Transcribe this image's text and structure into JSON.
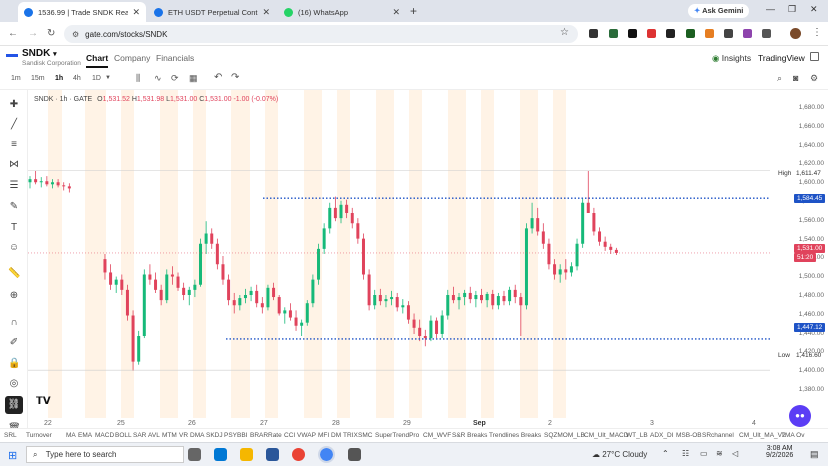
{
  "browser": {
    "tabs": [
      {
        "label": "1536.99 | Trade SNDK Real-Tim",
        "color": "#1a73e8",
        "active": true
      },
      {
        "label": "ETH USDT Perpetual Contract (",
        "color": "#1a73e8",
        "active": false
      },
      {
        "label": "(16) WhatsApp",
        "color": "#25d366",
        "active": false
      }
    ],
    "new_tab": "+",
    "ask_gemini": "Ask Gemini",
    "url": "gate.com/stocks/SNDK"
  },
  "app": {
    "symbol": "SNDK",
    "company_name": "Sandisk Corporation",
    "nav_tabs": [
      "Chart",
      "Company",
      "Financials"
    ],
    "insights": "Insights",
    "tradingview": "TradingView"
  },
  "toolbar": {
    "intervals": [
      "1m",
      "15m",
      "1h",
      "4h",
      "1D"
    ],
    "active_interval": "1h"
  },
  "legend": {
    "symbol": "SNDK · 1h · GATE",
    "o_label": "O",
    "o_value": "1,531.52",
    "h_label": "H",
    "h_value": "1,531.98",
    "l_label": "L",
    "l_value": "1,531.00",
    "c_label": "C",
    "c_value": "1,531.00",
    "change": "-1.00 (-0.07%)"
  },
  "price_axis": {
    "ticks": [
      "1,680.00",
      "1,660.00",
      "1,640.00",
      "1,620.00",
      "1,600.00",
      "1,580.00",
      "1,560.00",
      "1,540.00",
      "1,520.00",
      "1,500.00",
      "1,480.00",
      "1,460.00",
      "1,440.00",
      "1,420.00",
      "1,400.00",
      "1,380.00"
    ],
    "high_label": "High",
    "high_value": "1,611.47",
    "low_label": "Low",
    "low_value": "1,416.60",
    "resistance_value": "1,584.45",
    "support_value": "1,447.12",
    "last_value": "1,531.00",
    "countdown": "51:20"
  },
  "time_axis": {
    "labels": [
      "22",
      "25",
      "26",
      "27",
      "28",
      "29",
      "Sep",
      "2",
      "3",
      "4"
    ]
  },
  "indicators": [
    "SRL",
    "Turnover",
    "MA",
    "EMA",
    "MACD",
    "BOLL",
    "SAR",
    "AVL",
    "MTM",
    "VR",
    "DMA",
    "SKDJ",
    "PSY",
    "BBI",
    "BRAR",
    "Rate",
    "CCI",
    "VWAP",
    "MFI",
    "DM",
    "TRIX",
    "SMC",
    "SuperTrendPro",
    "CM_WVF",
    "S&R Breaks",
    "Trendlines Breaks",
    "SQZMOM_LB",
    "CM_Ult_MACD",
    "WT_LB",
    "ADX_DI",
    "MSB-OB",
    "SRchannel",
    "CM_Ult_MA_V2",
    "TMA Ov"
  ],
  "taskbar": {
    "search_placeholder": "Type here to search",
    "weather": "27°C  Cloudy",
    "time": "3:08 AM",
    "date": "9/2/2026"
  },
  "chart_data": {
    "type": "candlestick",
    "ylim": [
      1370,
      1690
    ],
    "high": 1611.47,
    "low": 1416.6,
    "resistance": 1584.45,
    "support": 1447.12,
    "last": 1531.0,
    "candles": [
      [
        1600,
        1606,
        1594,
        1603
      ],
      [
        1603,
        1611,
        1598,
        1600
      ],
      [
        1600,
        1605,
        1595,
        1601
      ],
      [
        1601,
        1606,
        1596,
        1598
      ],
      [
        1598,
        1603,
        1594,
        1600
      ],
      [
        1600,
        1603,
        1595,
        1597
      ],
      [
        1597,
        1600,
        1592,
        1596
      ],
      [
        1596,
        1599,
        1590,
        1594
      ],
      [
        1525,
        1530,
        1505,
        1512
      ],
      [
        1512,
        1520,
        1495,
        1500
      ],
      [
        1500,
        1508,
        1492,
        1505
      ],
      [
        1505,
        1510,
        1490,
        1495
      ],
      [
        1495,
        1500,
        1465,
        1470
      ],
      [
        1470,
        1475,
        1416,
        1425
      ],
      [
        1425,
        1455,
        1422,
        1450
      ],
      [
        1450,
        1515,
        1448,
        1510
      ],
      [
        1510,
        1520,
        1500,
        1505
      ],
      [
        1505,
        1512,
        1492,
        1495
      ],
      [
        1495,
        1500,
        1480,
        1485
      ],
      [
        1485,
        1515,
        1482,
        1510
      ],
      [
        1510,
        1518,
        1500,
        1508
      ],
      [
        1508,
        1512,
        1494,
        1497
      ],
      [
        1497,
        1502,
        1485,
        1490
      ],
      [
        1490,
        1498,
        1480,
        1495
      ],
      [
        1495,
        1505,
        1488,
        1500
      ],
      [
        1500,
        1545,
        1498,
        1540
      ],
      [
        1540,
        1562,
        1530,
        1550
      ],
      [
        1550,
        1555,
        1535,
        1540
      ],
      [
        1540,
        1545,
        1515,
        1520
      ],
      [
        1520,
        1528,
        1500,
        1505
      ],
      [
        1505,
        1510,
        1480,
        1485
      ],
      [
        1485,
        1492,
        1472,
        1480
      ],
      [
        1480,
        1490,
        1475,
        1487
      ],
      [
        1487,
        1496,
        1482,
        1490
      ],
      [
        1490,
        1498,
        1484,
        1494
      ],
      [
        1494,
        1500,
        1478,
        1482
      ],
      [
        1482,
        1488,
        1472,
        1478
      ],
      [
        1478,
        1500,
        1475,
        1497
      ],
      [
        1497,
        1502,
        1485,
        1488
      ],
      [
        1488,
        1490,
        1470,
        1472
      ],
      [
        1472,
        1478,
        1462,
        1475
      ],
      [
        1475,
        1482,
        1465,
        1468
      ],
      [
        1468,
        1475,
        1455,
        1460
      ],
      [
        1460,
        1466,
        1450,
        1463
      ],
      [
        1463,
        1485,
        1460,
        1482
      ],
      [
        1482,
        1510,
        1478,
        1505
      ],
      [
        1505,
        1540,
        1500,
        1535
      ],
      [
        1535,
        1560,
        1530,
        1555
      ],
      [
        1555,
        1580,
        1550,
        1575
      ],
      [
        1575,
        1586,
        1562,
        1565
      ],
      [
        1565,
        1582,
        1560,
        1578
      ],
      [
        1578,
        1583,
        1565,
        1570
      ],
      [
        1570,
        1575,
        1555,
        1560
      ],
      [
        1560,
        1565,
        1540,
        1545
      ],
      [
        1545,
        1550,
        1505,
        1510
      ],
      [
        1510,
        1515,
        1475,
        1480
      ],
      [
        1480,
        1495,
        1476,
        1490
      ],
      [
        1490,
        1496,
        1480,
        1484
      ],
      [
        1484,
        1490,
        1478,
        1486
      ],
      [
        1486,
        1494,
        1480,
        1488
      ],
      [
        1488,
        1492,
        1474,
        1478
      ],
      [
        1478,
        1486,
        1472,
        1480
      ],
      [
        1480,
        1484,
        1462,
        1466
      ],
      [
        1466,
        1472,
        1452,
        1458
      ],
      [
        1458,
        1466,
        1445,
        1450
      ],
      [
        1450,
        1456,
        1440,
        1448
      ],
      [
        1448,
        1470,
        1445,
        1465
      ],
      [
        1465,
        1468,
        1448,
        1452
      ],
      [
        1452,
        1475,
        1448,
        1470
      ],
      [
        1470,
        1495,
        1466,
        1490
      ],
      [
        1490,
        1498,
        1482,
        1485
      ],
      [
        1485,
        1492,
        1476,
        1488
      ],
      [
        1488,
        1495,
        1480,
        1492
      ],
      [
        1492,
        1498,
        1482,
        1486
      ],
      [
        1486,
        1494,
        1478,
        1490
      ],
      [
        1490,
        1496,
        1482,
        1485
      ],
      [
        1485,
        1493,
        1478,
        1491
      ],
      [
        1491,
        1495,
        1476,
        1480
      ],
      [
        1480,
        1492,
        1476,
        1489
      ],
      [
        1489,
        1494,
        1480,
        1484
      ],
      [
        1484,
        1498,
        1480,
        1495
      ],
      [
        1495,
        1500,
        1482,
        1488
      ],
      [
        1488,
        1492,
        1450,
        1480
      ],
      [
        1480,
        1560,
        1476,
        1555
      ],
      [
        1555,
        1580,
        1550,
        1565
      ],
      [
        1565,
        1575,
        1548,
        1552
      ],
      [
        1552,
        1560,
        1535,
        1540
      ],
      [
        1540,
        1545,
        1515,
        1520
      ],
      [
        1520,
        1525,
        1505,
        1510
      ],
      [
        1510,
        1520,
        1502,
        1515
      ],
      [
        1515,
        1525,
        1505,
        1512
      ],
      [
        1512,
        1522,
        1508,
        1518
      ],
      [
        1518,
        1545,
        1514,
        1540
      ],
      [
        1540,
        1585,
        1536,
        1580
      ],
      [
        1580,
        1611,
        1575,
        1570
      ],
      [
        1570,
        1575,
        1548,
        1552
      ],
      [
        1552,
        1556,
        1538,
        1542
      ],
      [
        1542,
        1547,
        1533,
        1537
      ],
      [
        1537,
        1540,
        1530,
        1534
      ],
      [
        1534,
        1536,
        1529,
        1531
      ]
    ]
  }
}
